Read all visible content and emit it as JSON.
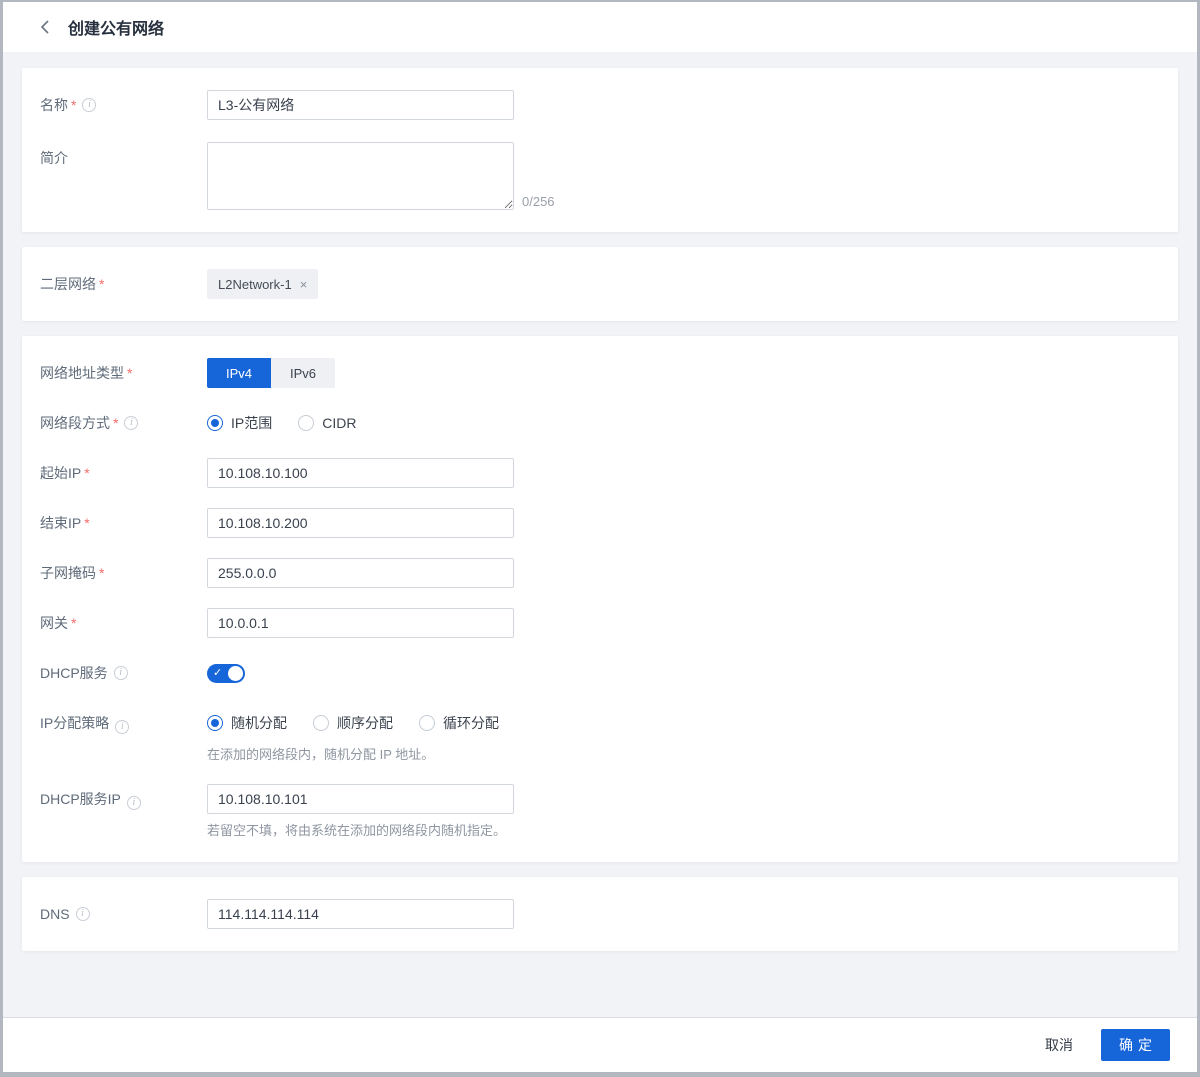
{
  "ui": {
    "required_marker": "*",
    "info_icon": "i",
    "check_icon": "✓",
    "remove_icon": "×"
  },
  "colors": {
    "accent_blue": "#1766d9",
    "danger_red": "#f56c6c",
    "page_bg": "#f1f3f6"
  },
  "header": {
    "title": "创建公有网络"
  },
  "form": {
    "name": {
      "label": "名称",
      "value": "L3-公有网络"
    },
    "description": {
      "label": "简介",
      "value": "",
      "counter": "0/256"
    },
    "l2network": {
      "label": "二层网络",
      "tag": "L2Network-1"
    },
    "ip_version": {
      "label": "网络地址类型",
      "options": [
        "IPv4",
        "IPv6"
      ],
      "selected": "IPv4"
    },
    "segment_mode": {
      "label": "网络段方式",
      "options": [
        "IP范围",
        "CIDR"
      ],
      "selected": "IP范围"
    },
    "start_ip": {
      "label": "起始IP",
      "value": "10.108.10.100"
    },
    "end_ip": {
      "label": "结束IP",
      "value": "10.108.10.200"
    },
    "netmask": {
      "label": "子网掩码",
      "value": "255.0.0.0"
    },
    "gateway": {
      "label": "网关",
      "value": "10.0.0.1"
    },
    "dhcp": {
      "label": "DHCP服务",
      "enabled": true
    },
    "alloc": {
      "label": "IP分配策略",
      "options": [
        "随机分配",
        "顺序分配",
        "循环分配"
      ],
      "selected": "随机分配",
      "hint": "在添加的网络段内，随机分配 IP 地址。"
    },
    "dhcp_ip": {
      "label": "DHCP服务IP",
      "value": "10.108.10.101",
      "hint": "若留空不填，将由系统在添加的网络段内随机指定。"
    },
    "dns": {
      "label": "DNS",
      "value": "114.114.114.114"
    }
  },
  "footer": {
    "cancel": "取消",
    "confirm": "确定"
  }
}
